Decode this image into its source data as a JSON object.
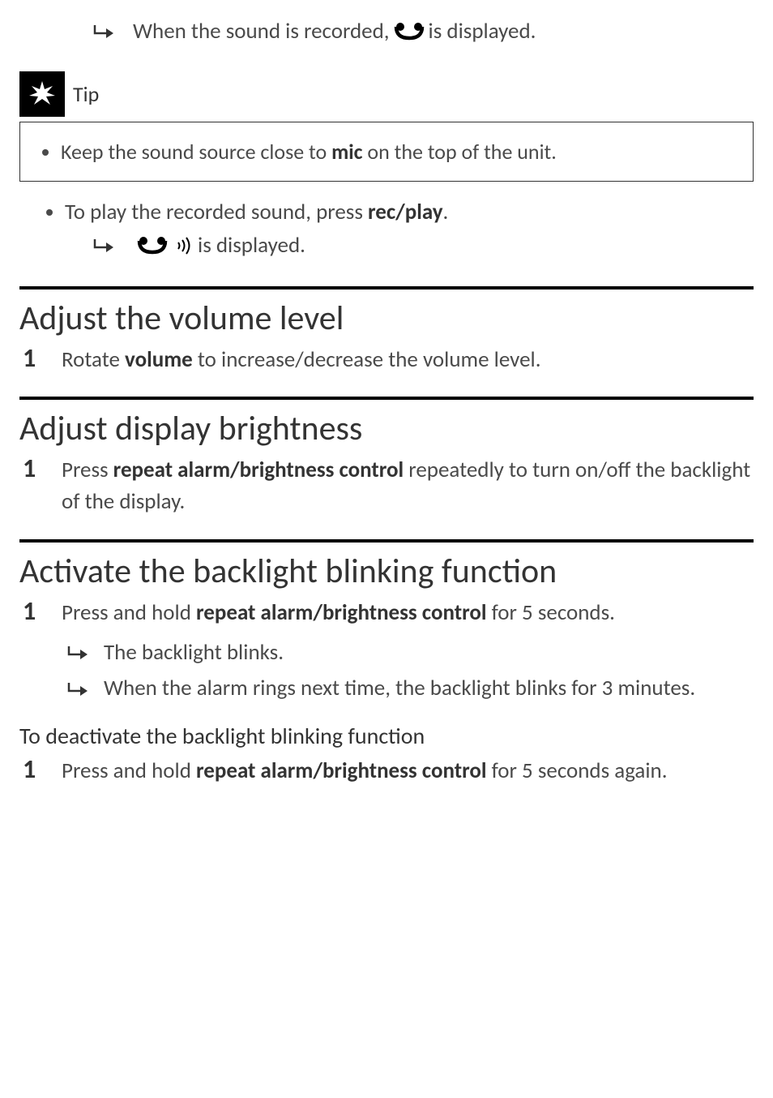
{
  "top_result": {
    "before": "When the sound is recorded,",
    "after": " is displayed."
  },
  "tip": {
    "label": "Tip",
    "item_before": "Keep the sound source close to ",
    "item_bold": "mic",
    "item_after": " on the top of the unit."
  },
  "play": {
    "line_before": "To play the recorded sound, press ",
    "line_bold": "rec/play",
    "line_after": ".",
    "result_after": " is displayed."
  },
  "volume": {
    "heading": "Adjust the volume level",
    "step_num": "1",
    "step_before": "Rotate ",
    "step_bold": "volume",
    "step_after": " to increase/decrease the volume level."
  },
  "brightness": {
    "heading": "Adjust display brightness",
    "step_num": "1",
    "step_before": "Press ",
    "step_bold": "repeat alarm/brightness control",
    "step_after": " repeatedly to turn on/off the backlight of the display."
  },
  "backlight": {
    "heading": "Activate the backlight blinking function",
    "step_num": "1",
    "step_before": "Press and hold ",
    "step_bold": "repeat alarm/brightness control",
    "step_after": " for 5 seconds.",
    "res1": "The backlight blinks.",
    "res2": "When the alarm rings next time, the backlight blinks for 3 minutes.",
    "deact_heading": "To deactivate the backlight blinking function",
    "deact_step_num": "1",
    "deact_before": "Press and hold ",
    "deact_bold": "repeat alarm/brightness control",
    "deact_after": " for 5 seconds again."
  }
}
